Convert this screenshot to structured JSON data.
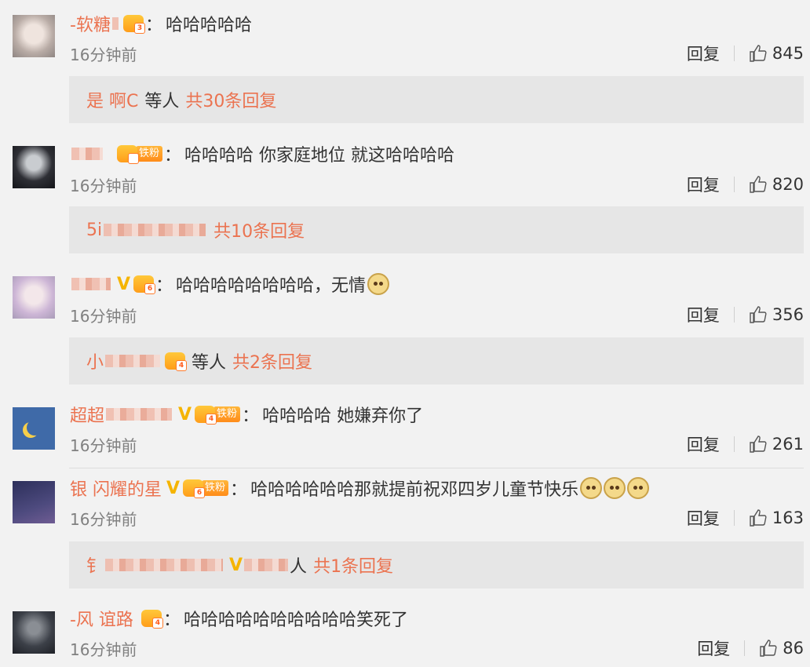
{
  "comments": [
    {
      "username": "-软糖",
      "level": "3",
      "fan_badge": "",
      "verified": false,
      "text": "哈哈哈哈哈",
      "emoji_count": 0,
      "time": "16分钟前",
      "reply_label": "回复",
      "likes": "845",
      "sub": {
        "user": "是  啊C",
        "mid": "等人",
        "count": "共30条回复"
      }
    },
    {
      "username": "",
      "level": "",
      "fan_badge": "铁粉",
      "verified": false,
      "text": "哈哈哈哈 你家庭地位 就这哈哈哈哈",
      "emoji_count": 0,
      "time": "16分钟前",
      "reply_label": "回复",
      "likes": "820",
      "sub": {
        "user": "5i",
        "mid": "",
        "count": "共10条回复"
      }
    },
    {
      "username": "",
      "level": "6",
      "fan_badge": "",
      "verified": true,
      "text": "哈哈哈哈哈哈哈哈，无情",
      "emoji_count": 1,
      "time": "16分钟前",
      "reply_label": "回复",
      "likes": "356",
      "sub": {
        "user": "小",
        "mid": "等人",
        "count": "共2条回复"
      }
    },
    {
      "username": "超超",
      "level": "4",
      "fan_badge": "铁粉",
      "verified": true,
      "text": "哈哈哈哈  她嫌弃你了",
      "emoji_count": 0,
      "time": "16分钟前",
      "reply_label": "回复",
      "likes": "261",
      "sub": null
    },
    {
      "username": "银  闪耀的星",
      "level": "6",
      "fan_badge": "铁粉",
      "verified": true,
      "text": "哈哈哈哈哈哈那就提前祝邓四岁儿童节快乐",
      "emoji_count": 3,
      "time": "16分钟前",
      "reply_label": "回复",
      "likes": "163",
      "sub": {
        "user": "钅",
        "mid": "人",
        "count": "共1条回复"
      }
    },
    {
      "username": "-风  谊路",
      "level": "4",
      "fan_badge": "",
      "verified": false,
      "text": "哈哈哈哈哈哈哈哈哈哈笑死了",
      "emoji_count": 0,
      "time": "16分钟前",
      "reply_label": "回复",
      "likes": "86",
      "sub": null
    }
  ],
  "colors": {
    "accent": "#eb7350",
    "bg": "#f2f2f2",
    "subbox": "#e6e6e6",
    "badge": "#f5b400"
  }
}
